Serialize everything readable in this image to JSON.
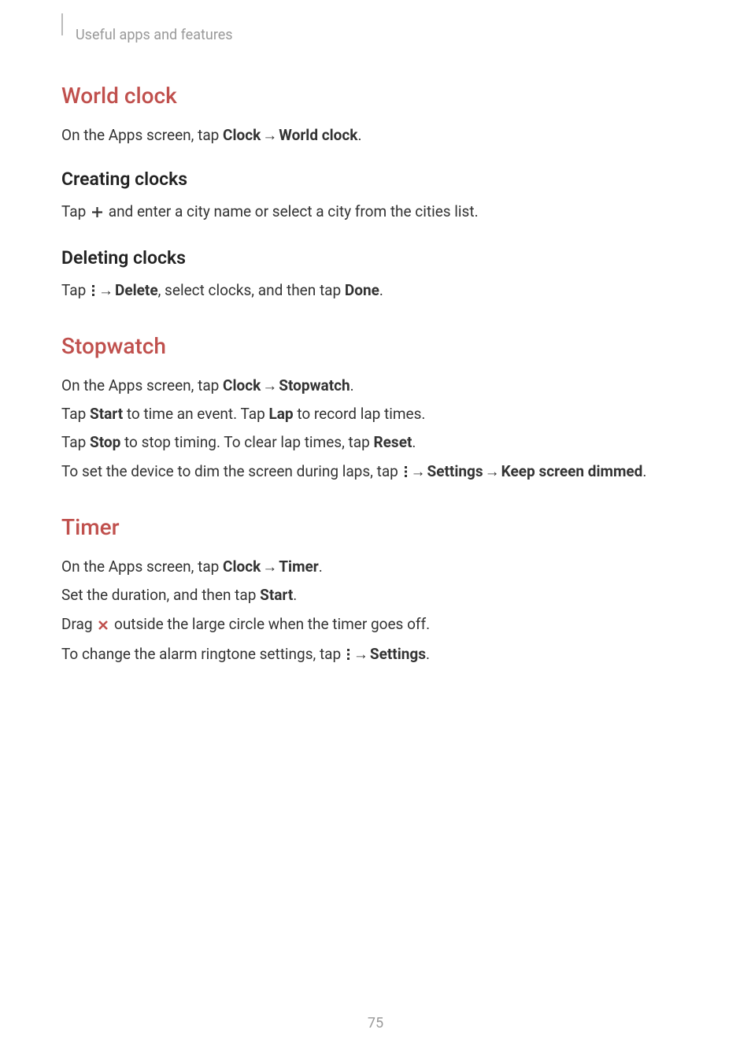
{
  "header": {
    "breadcrumb": "Useful apps and features"
  },
  "sections": {
    "worldClock": {
      "title": "World clock",
      "intro_pre": "On the Apps screen, tap ",
      "intro_bold1": "Clock",
      "intro_mid": " → ",
      "intro_bold2": "World clock",
      "intro_post": ".",
      "creating": {
        "title": "Creating clocks",
        "body_pre": "Tap ",
        "body_post": " and enter a city name or select a city from the cities list."
      },
      "deleting": {
        "title": "Deleting clocks",
        "body_pre": "Tap ",
        "body_mid1": " → ",
        "body_bold1": "Delete",
        "body_mid2": ", select clocks, and then tap ",
        "body_bold2": "Done",
        "body_post": "."
      }
    },
    "stopwatch": {
      "title": "Stopwatch",
      "line1_pre": "On the Apps screen, tap ",
      "line1_bold1": "Clock",
      "line1_mid": " → ",
      "line1_bold2": "Stopwatch",
      "line1_post": ".",
      "line2_pre": "Tap ",
      "line2_bold1": "Start",
      "line2_mid1": " to time an event. Tap ",
      "line2_bold2": "Lap",
      "line2_post": " to record lap times.",
      "line3_pre": "Tap ",
      "line3_bold1": "Stop",
      "line3_mid1": " to stop timing. To clear lap times, tap ",
      "line3_bold2": "Reset",
      "line3_post": ".",
      "line4_pre": "To set the device to dim the screen during laps, tap ",
      "line4_mid1": " → ",
      "line4_bold1": "Settings",
      "line4_mid2": " → ",
      "line4_bold2": "Keep screen dimmed",
      "line4_post": "."
    },
    "timer": {
      "title": "Timer",
      "line1_pre": "On the Apps screen, tap ",
      "line1_bold1": "Clock",
      "line1_mid": " → ",
      "line1_bold2": "Timer",
      "line1_post": ".",
      "line2_pre": "Set the duration, and then tap ",
      "line2_bold1": "Start",
      "line2_post": ".",
      "line3_pre": "Drag ",
      "line3_post": " outside the large circle when the timer goes off.",
      "line4_pre": "To change the alarm ringtone settings, tap ",
      "line4_mid": " → ",
      "line4_bold1": "Settings",
      "line4_post": "."
    }
  },
  "pageNumber": "75"
}
